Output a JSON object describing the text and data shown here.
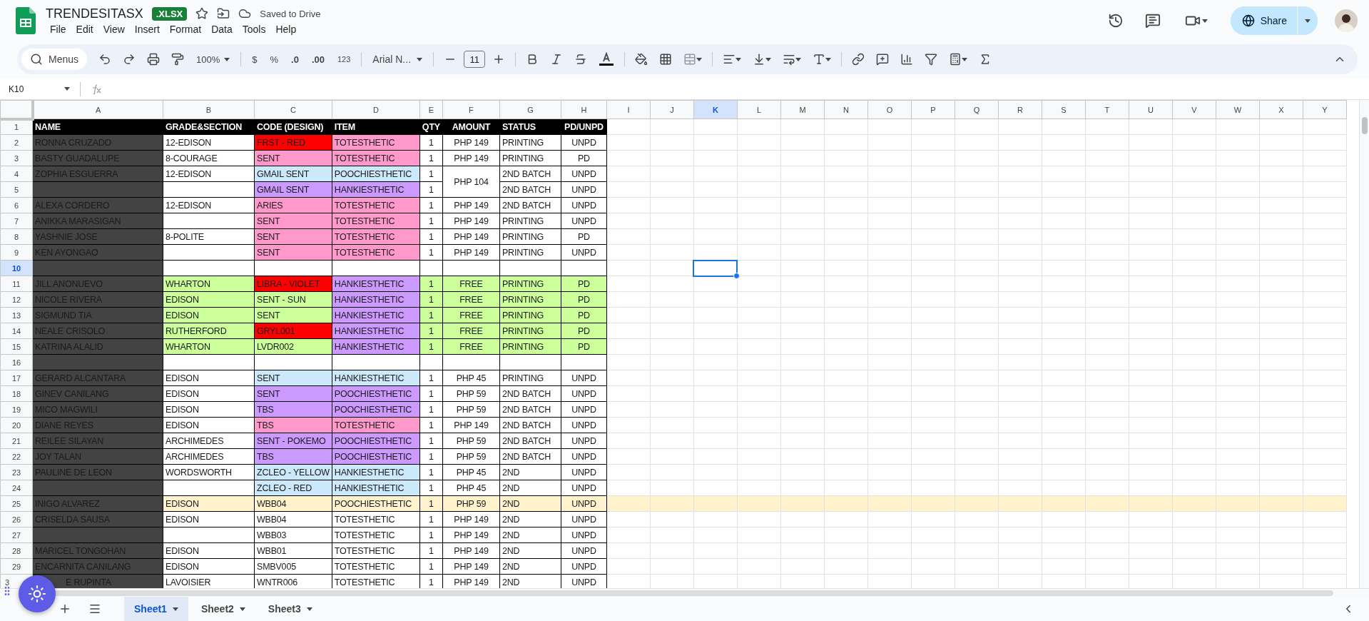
{
  "app": {
    "title": "TRENDESITASX",
    "badge": ".XLSX",
    "save_status": "Saved to Drive",
    "menu": [
      "File",
      "Edit",
      "View",
      "Insert",
      "Format",
      "Data",
      "Tools",
      "Help"
    ],
    "share": "Share"
  },
  "toolbar": {
    "search": "Menus",
    "zoom": "100%",
    "currency": "$",
    "percent": "%",
    "decrease_decimal": ".0",
    "increase_decimal": ".00",
    "number_format": "123",
    "font": "Arial N...",
    "font_size": "11"
  },
  "formula_bar": {
    "name_box": "K10"
  },
  "columns": [
    {
      "label": "A",
      "selected": false
    },
    {
      "label": "B",
      "selected": false
    },
    {
      "label": "C",
      "selected": false
    },
    {
      "label": "D",
      "selected": false
    },
    {
      "label": "E",
      "selected": false
    },
    {
      "label": "F",
      "selected": false
    },
    {
      "label": "G",
      "selected": false
    },
    {
      "label": "H",
      "selected": false
    },
    {
      "label": "I",
      "selected": false
    },
    {
      "label": "J",
      "selected": false
    },
    {
      "label": "K",
      "selected": true
    },
    {
      "label": "L",
      "selected": false
    },
    {
      "label": "M",
      "selected": false
    },
    {
      "label": "N",
      "selected": false
    },
    {
      "label": "O",
      "selected": false
    },
    {
      "label": "P",
      "selected": false
    },
    {
      "label": "Q",
      "selected": false
    },
    {
      "label": "R",
      "selected": false
    },
    {
      "label": "S",
      "selected": false
    },
    {
      "label": "T",
      "selected": false
    },
    {
      "label": "U",
      "selected": false
    },
    {
      "label": "V",
      "selected": false
    },
    {
      "label": "W",
      "selected": false
    },
    {
      "label": "X",
      "selected": false
    },
    {
      "label": "Y",
      "selected": false
    }
  ],
  "header_row": {
    "number": "1",
    "cells": [
      "NAME",
      "GRADE&SECTION",
      "CODE (DESIGN)",
      "ITEM",
      "QTY",
      "AMOUNT",
      "STATUS",
      "PD/UNPD"
    ]
  },
  "rows": [
    {
      "number": "2",
      "selected": false,
      "name": "RONNA CRUZADO",
      "grade": "12-EDISON",
      "code": {
        "text": "FRST - RED",
        "color": "#ff0000"
      },
      "item": {
        "text": "TOTESTHETIC",
        "color": "#ff99cc"
      },
      "qty": "1",
      "amount": "PHP 149",
      "status": "PRINTING",
      "paid": "UNPD"
    },
    {
      "number": "3",
      "selected": false,
      "name": "BASTY GUADALUPE",
      "grade": "8-COURAGE",
      "code": {
        "text": "SENT",
        "color": "#ff99cc"
      },
      "item": {
        "text": "TOTESTHETIC",
        "color": "#ff99cc"
      },
      "qty": "1",
      "amount": "PHP 149",
      "status": "PRINTING",
      "paid": "PD"
    },
    {
      "number": "4",
      "selected": false,
      "name": "ZOPHIA ESGUERRA",
      "grade": "12-EDISON",
      "code": {
        "text": "GMAIL SENT",
        "color": "#cce8fb"
      },
      "item": {
        "text": "POOCHIESTHETIC",
        "color": "#cce8fb"
      },
      "qty": "1",
      "amount": "PHP 104",
      "amount_merged": true,
      "status": "2ND BATCH",
      "paid": "UNPD"
    },
    {
      "number": "5",
      "selected": false,
      "code": {
        "text": "GMAIL SENT",
        "color": "#cc99ff"
      },
      "item": {
        "text": "HANKIESTHETIC",
        "color": "#cc99ff"
      },
      "qty": "1",
      "status": "2ND BATCH",
      "paid": "UNPD"
    },
    {
      "number": "6",
      "selected": false,
      "name": "ALEXA CORDERO",
      "grade": "12-EDISON",
      "code": {
        "text": "ARIES",
        "color": "#ff99cc"
      },
      "item": {
        "text": "TOTESTHETIC",
        "color": "#ff99cc"
      },
      "qty": "1",
      "amount": "PHP 149",
      "status": "2ND BATCH",
      "paid": "UNPD"
    },
    {
      "number": "7",
      "selected": false,
      "name": "ANIKKA MARASIGAN",
      "code": {
        "text": "SENT",
        "color": "#ff99cc"
      },
      "item": {
        "text": "TOTESTHETIC",
        "color": "#ff99cc"
      },
      "qty": "1",
      "amount": "PHP 149",
      "status": "PRINTING",
      "paid": "UNPD"
    },
    {
      "number": "8",
      "selected": false,
      "name": "YASHNIE JOSE",
      "grade": "8-POLITE",
      "code": {
        "text": "SENT",
        "color": "#ff99cc"
      },
      "item": {
        "text": "TOTESTHETIC",
        "color": "#ff99cc"
      },
      "qty": "1",
      "amount": "PHP 149",
      "status": "PRINTING",
      "paid": "PD"
    },
    {
      "number": "9",
      "selected": false,
      "name": "KEN AYONGAO",
      "code": {
        "text": "SENT",
        "color": "#ff99cc"
      },
      "item": {
        "text": "TOTESTHETIC",
        "color": "#ff99cc"
      },
      "qty": "1",
      "amount": "PHP 149",
      "status": "PRINTING",
      "paid": "UNPD"
    },
    {
      "number": "10",
      "selected": true
    },
    {
      "number": "11",
      "selected": false,
      "color": "#ccff99",
      "name": "JILL ANONUEVO",
      "grade": "WHARTON",
      "code": {
        "text": "LIBRA - VIOLET",
        "color": "#ff0000"
      },
      "item": {
        "text": "HANKIESTHETIC",
        "color": "#cc99ff"
      },
      "qty": "1",
      "amount": "FREE",
      "status": "PRINTING",
      "paid": "PD"
    },
    {
      "number": "12",
      "selected": false,
      "color": "#ccff99",
      "name": "NICOLE RIVERA",
      "grade": "EDISON",
      "code": {
        "text": "SENT - SUN"
      },
      "item": {
        "text": "HANKIESTHETIC",
        "color": "#cc99ff"
      },
      "qty": "1",
      "amount": "FREE",
      "status": "PRINTING",
      "paid": "PD"
    },
    {
      "number": "13",
      "selected": false,
      "color": "#ccff99",
      "name": "SIGMUND TIA",
      "grade": "EDISON",
      "code": {
        "text": "SENT"
      },
      "item": {
        "text": "HANKIESTHETIC",
        "color": "#cc99ff"
      },
      "qty": "1",
      "amount": "FREE",
      "status": "PRINTING",
      "paid": "PD"
    },
    {
      "number": "14",
      "selected": false,
      "color": "#ccff99",
      "name": "NEALE CRISOLO",
      "grade": "RUTHERFORD",
      "code": {
        "text": "GRYL001",
        "color": "#ff0000"
      },
      "item": {
        "text": "HANKIESTHETIC",
        "color": "#cc99ff"
      },
      "qty": "1",
      "amount": "FREE",
      "status": "PRINTING",
      "paid": "PD"
    },
    {
      "number": "15",
      "selected": false,
      "color": "#ccff99",
      "name": "KATRINA ALALID",
      "grade": "WHARTON",
      "code": {
        "text": "LVDR002"
      },
      "item": {
        "text": "HANKIESTHETIC",
        "color": "#cc99ff"
      },
      "qty": "1",
      "amount": "FREE",
      "status": "PRINTING",
      "paid": "PD"
    },
    {
      "number": "16",
      "selected": false
    },
    {
      "number": "17",
      "selected": false,
      "name": "GERARD ALCANTARA",
      "grade": "EDISON",
      "code": {
        "text": "SENT",
        "color": "#cce8fb"
      },
      "item": {
        "text": "HANKIESTHETIC",
        "color": "#cce8fb"
      },
      "qty": "1",
      "amount": "PHP 45",
      "status": "PRINTING",
      "paid": "UNPD"
    },
    {
      "number": "18",
      "selected": false,
      "name": "GINEV CANILANG",
      "grade": "EDISON",
      "code": {
        "text": "SENT",
        "color": "#cc99ff"
      },
      "item": {
        "text": "POOCHIESTHETIC",
        "color": "#cc99ff"
      },
      "qty": "1",
      "amount": "PHP 59",
      "status": "2ND BATCH",
      "paid": "UNPD"
    },
    {
      "number": "19",
      "selected": false,
      "name": "MICO MAGWILI",
      "grade": "EDISON",
      "code": {
        "text": "TBS",
        "color": "#cc99ff"
      },
      "item": {
        "text": "POOCHIESTHETIC",
        "color": "#cc99ff"
      },
      "qty": "1",
      "amount": "PHP 59",
      "status": "2ND BATCH",
      "paid": "UNPD"
    },
    {
      "number": "20",
      "selected": false,
      "name": "DIANE REYES",
      "grade": "EDISON",
      "code": {
        "text": "TBS",
        "color": "#ff99cc"
      },
      "item": {
        "text": "TOTESTHETIC",
        "color": "#ff99cc"
      },
      "qty": "1",
      "amount": "PHP 149",
      "status": "2ND BATCH",
      "paid": "UNPD"
    },
    {
      "number": "21",
      "selected": false,
      "name": "REILEE SILAYAN",
      "grade": "ARCHIMEDES",
      "code": {
        "text": "SENT - POKEMO",
        "color": "#cc99ff"
      },
      "item": {
        "text": "POOCHIESTHETIC",
        "color": "#cc99ff"
      },
      "qty": "1",
      "amount": "PHP 59",
      "status": "2ND BATCH",
      "paid": "UNPD"
    },
    {
      "number": "22",
      "selected": false,
      "name": "JOY TALAN",
      "grade": "ARCHIMEDES",
      "code": {
        "text": "TBS",
        "color": "#cc99ff"
      },
      "item": {
        "text": "POOCHIESTHETIC",
        "color": "#cc99ff"
      },
      "qty": "1",
      "amount": "PHP 59",
      "status": "2ND BATCH",
      "paid": "UNPD"
    },
    {
      "number": "23",
      "selected": false,
      "name": "PAULINE DE LEON",
      "grade": "WORDSWORTH",
      "code": {
        "text": "ZCLEO - YELLOW",
        "color": "#cce8fb"
      },
      "item": {
        "text": "HANKIESTHETIC",
        "color": "#cce8fb"
      },
      "qty": "1",
      "amount": "PHP 45",
      "status": "2ND",
      "paid": "UNPD"
    },
    {
      "number": "24",
      "selected": false,
      "code": {
        "text": "ZCLEO - RED",
        "color": "#cce8fb"
      },
      "item": {
        "text": "HANKIESTHETIC",
        "color": "#cce8fb"
      },
      "qty": "1",
      "amount": "PHP 45",
      "status": "2ND",
      "paid": "UNPD"
    },
    {
      "number": "25",
      "selected": false,
      "color": "#fff2cc",
      "whole_row": true,
      "name": "INIGO ALVAREZ",
      "grade": "EDISON",
      "code": {
        "text": "WBB04"
      },
      "item": {
        "text": "POOCHIESTHETIC"
      },
      "qty": "1",
      "amount": "PHP 59",
      "status": "2ND",
      "paid": "UNPD"
    },
    {
      "number": "26",
      "selected": false,
      "name": "CRISELDA SAUSA",
      "grade": "EDISON",
      "code": {
        "text": "WBB04"
      },
      "item": {
        "text": "TOTESTHETIC"
      },
      "qty": "1",
      "amount": "PHP 149",
      "status": "2ND",
      "paid": "UNPD"
    },
    {
      "number": "27",
      "selected": false,
      "code": {
        "text": "WBB03"
      },
      "item": {
        "text": "TOTESTHETIC"
      },
      "qty": "1",
      "amount": "PHP 149",
      "status": "2ND",
      "paid": "UNPD"
    },
    {
      "number": "28",
      "selected": false,
      "name": "MARICEL TONGOHAN",
      "grade": "EDISON",
      "code": {
        "text": "WBB01"
      },
      "item": {
        "text": "TOTESTHETIC"
      },
      "qty": "1",
      "amount": "PHP 149",
      "status": "2ND",
      "paid": "UNPD"
    },
    {
      "number": "29",
      "selected": false,
      "name": "ENCARNITA CANILANG",
      "grade": "EDISON",
      "code": {
        "text": "SMBV005"
      },
      "item": {
        "text": "TOTESTHETIC"
      },
      "qty": "1",
      "amount": "PHP 149",
      "status": "2ND",
      "paid": "UNPD"
    },
    {
      "number": "3",
      "selected": false,
      "name": "E RUPINTA",
      "grade": "LAVOISIER",
      "code": {
        "text": "WNTR006"
      },
      "item": {
        "text": "TOTESTHETIC"
      },
      "qty": "1",
      "amount": "PHP 149",
      "status": "2ND",
      "paid": "UNPD"
    }
  ],
  "sheets": [
    {
      "label": "Sheet1",
      "selected": true
    },
    {
      "label": "Sheet2",
      "selected": false
    },
    {
      "label": "Sheet3",
      "selected": false
    }
  ]
}
